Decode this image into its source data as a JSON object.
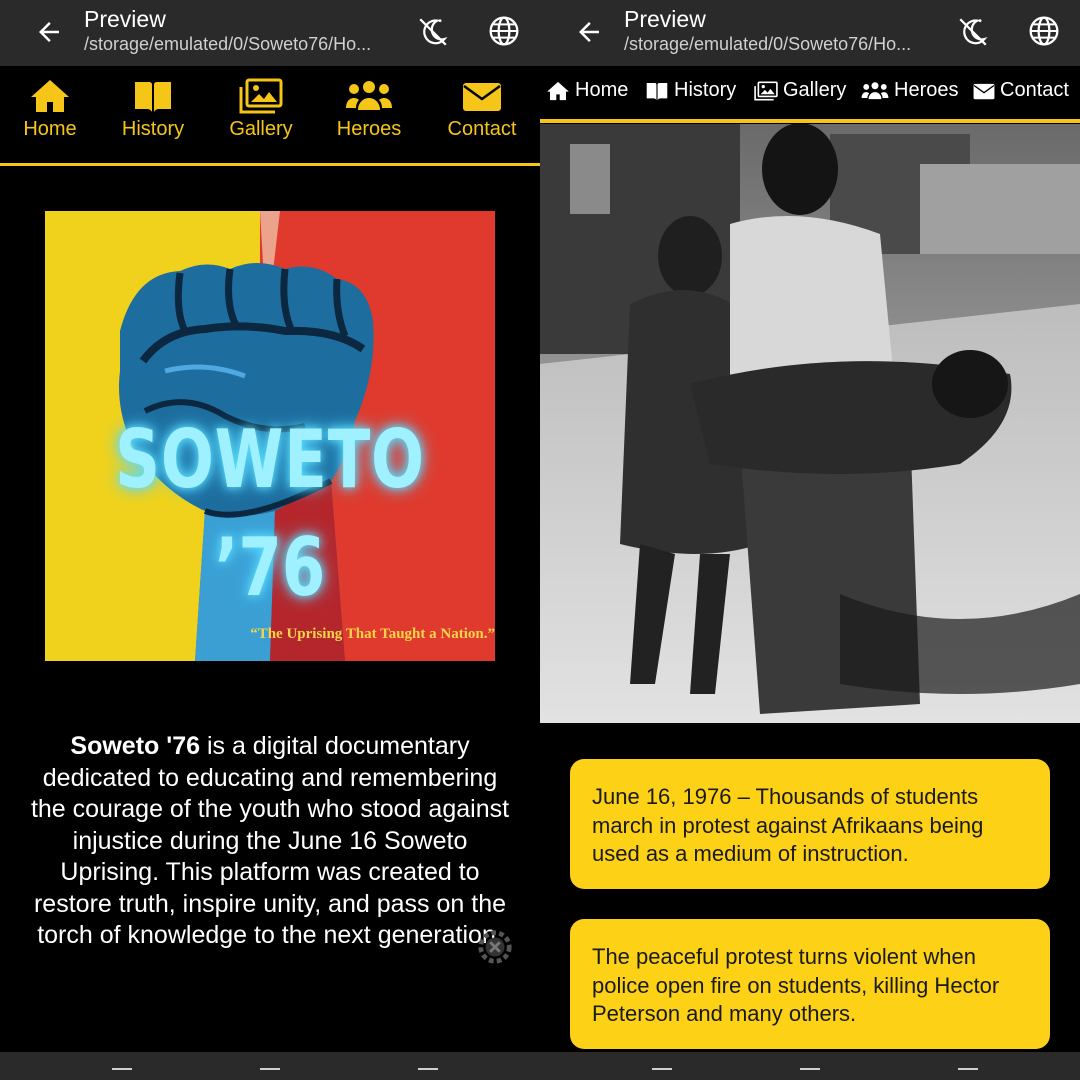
{
  "left": {
    "appbar": {
      "title": "Preview",
      "path": "/storage/emulated/0/Soweto76/Ho..."
    },
    "nav": [
      {
        "label": "Home",
        "icon": "home-icon"
      },
      {
        "label": "History",
        "icon": "book-icon"
      },
      {
        "label": "Gallery",
        "icon": "images-icon"
      },
      {
        "label": "Heroes",
        "icon": "users-icon"
      },
      {
        "label": "Contact",
        "icon": "envelope-icon"
      }
    ],
    "poster": {
      "title_line1": "SOWETO",
      "title_line2": "’76",
      "tagline": "“The Uprising That Taught a Nation.”"
    },
    "intro": {
      "bold": "Soweto '76",
      "text": " is a digital documentary dedicated to educating and remembering the courage of the youth who stood against injustice during the June 16 Soweto Uprising. This platform was created to restore truth, inspire unity, and pass on the torch of knowledge to the next generation."
    }
  },
  "right": {
    "appbar": {
      "title": "Preview",
      "path": "/storage/emulated/0/Soweto76/Ho..."
    },
    "nav": [
      {
        "label": "Home",
        "icon": "home-icon"
      },
      {
        "label": "History",
        "icon": "book-icon"
      },
      {
        "label": "Gallery",
        "icon": "images-icon"
      },
      {
        "label": "Heroes",
        "icon": "users-icon"
      },
      {
        "label": "Contact",
        "icon": "envelope-icon"
      }
    ],
    "cards": [
      "June 16, 1976 – Thousands of students march in protest against Afrikaans being used as a medium of instruction.",
      "The peaceful protest turns violent when police open fire on students, killing Hector Peterson and many others."
    ]
  },
  "colors": {
    "accent": "#f5c518",
    "card": "#fcd116",
    "appbar": "#2a2a2a",
    "background": "#000000"
  }
}
